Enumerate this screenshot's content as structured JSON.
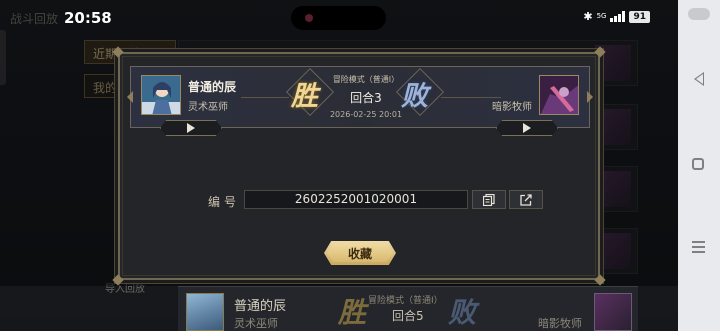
{
  "status_bar": {
    "time": "20:58",
    "network": "5G",
    "battery": "91"
  },
  "background": {
    "screen_title": "战斗回放",
    "tab_recent": "近期回放",
    "tab_mine": "我的",
    "import_label": "导入回放",
    "bottom_row": {
      "player_name": "普通的辰",
      "player_class": "灵术巫师",
      "result_win": "胜",
      "mode": "冒险模式（普通Ⅰ）",
      "round": "回合5",
      "result_lose": "败",
      "opponent_class": "暗影牧师"
    }
  },
  "modal": {
    "player": {
      "name": "普通的辰",
      "class": "灵术巫师"
    },
    "result_left": "胜",
    "result_right": "败",
    "mode": "冒险模式（普通Ⅰ）",
    "round": "回合3",
    "datetime": "2026-02-25 20:01",
    "opponent": {
      "class": "暗影牧师"
    },
    "id_label": "编号",
    "id_value": "2602252001020001",
    "favorite_label": "收藏"
  },
  "colors": {
    "accent_gold": "#d8b96e",
    "win": "#f0d795",
    "lose": "#9fb3d6"
  },
  "icons": {
    "play": "play-icon",
    "copy": "copy-icon",
    "share": "share-icon",
    "back": "back-icon",
    "home": "home-icon",
    "menu": "menu-icon"
  }
}
